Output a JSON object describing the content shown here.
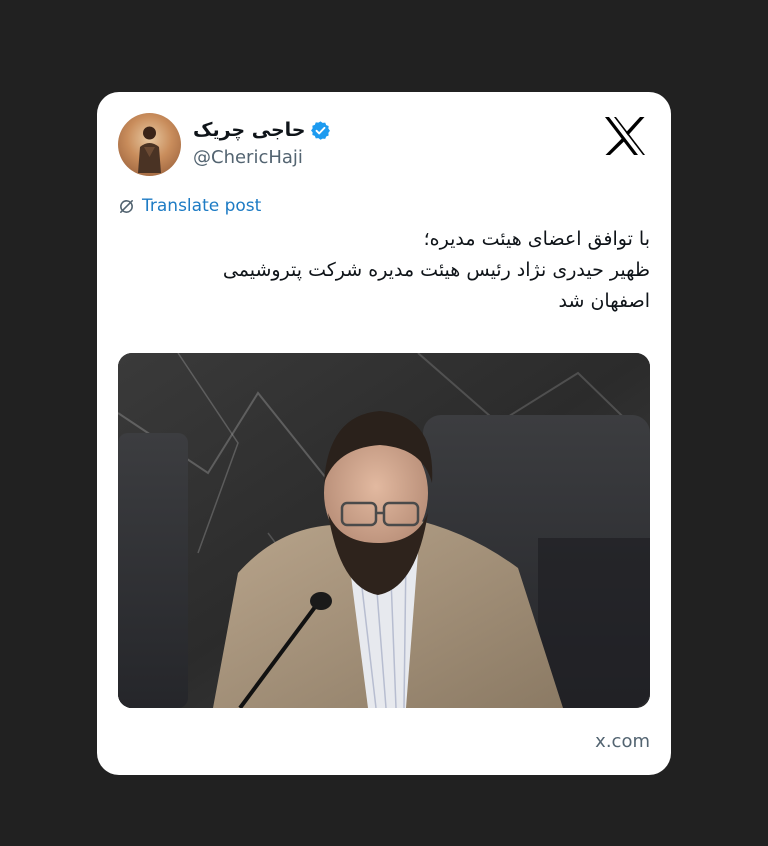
{
  "author": {
    "display_name": "حاجی چریک",
    "handle": "@ChericHaji",
    "verified": true,
    "avatar_icon": "avatar-photo"
  },
  "platform": {
    "logo_icon": "x-logo-icon"
  },
  "translate": {
    "icon": "globe-slash-icon",
    "label": "Translate post"
  },
  "post": {
    "lines": [
      "با توافق اعضای هیئت مدیره؛",
      "ظهیر حیدری نژاد رئیس هیئت مدیره شرکت پتروشیمی",
      "اصفهان شد"
    ]
  },
  "media": {
    "icon": "news-photo"
  },
  "footer": {
    "domain": "x.com"
  },
  "colors": {
    "background": "#212121",
    "card": "#ffffff",
    "text": "#0f1419",
    "secondary": "#536471",
    "link": "#1d7bc4",
    "verified": "#1d9bf0"
  }
}
